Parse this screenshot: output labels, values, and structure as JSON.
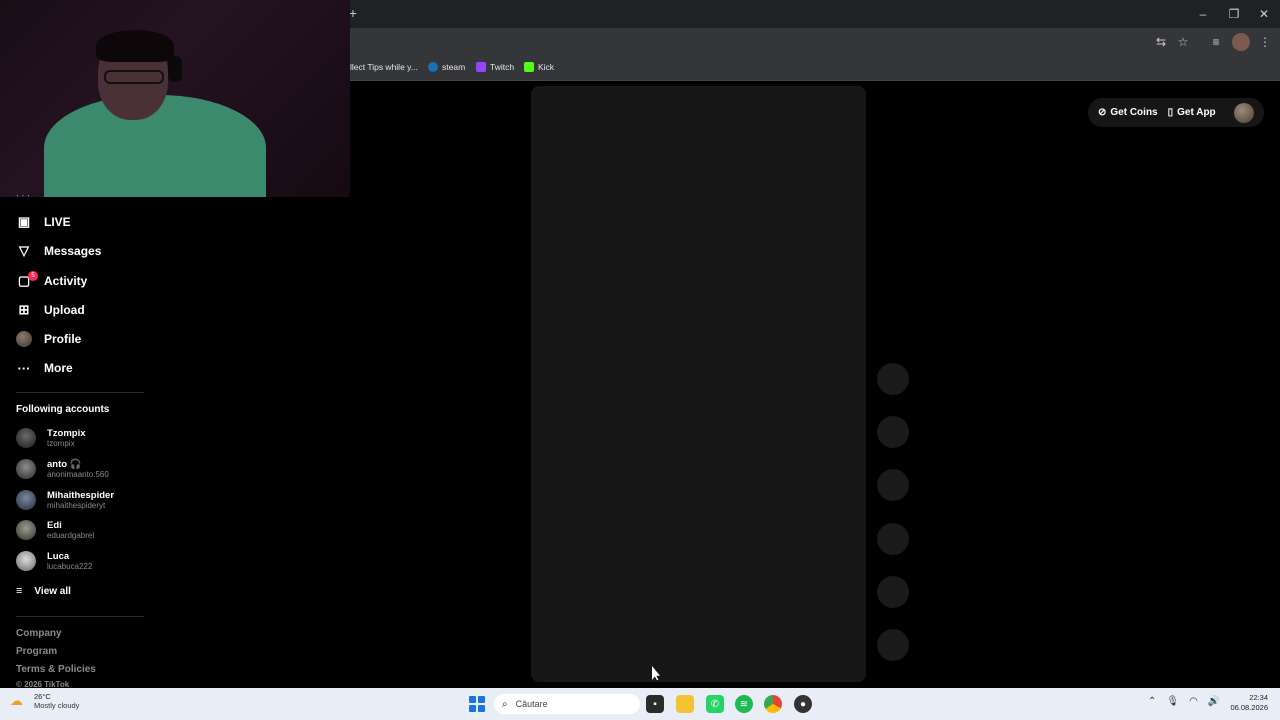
{
  "browser": {
    "new_tab_label": "+",
    "window_controls": {
      "minimize": "–",
      "restore": "❐",
      "close": "✕"
    },
    "bookmarks": [
      {
        "label": "llect Tips while y...",
        "icon": "bookmark-icon",
        "color": "#35363a"
      },
      {
        "label": "steam",
        "icon": "steam-icon",
        "color": "#1b2838"
      },
      {
        "label": "Twitch",
        "icon": "twitch-icon",
        "color": "#9146ff"
      },
      {
        "label": "Kick",
        "icon": "kick-icon",
        "color": "#53fc18"
      }
    ]
  },
  "sidebar": {
    "more_dots": "· · ·",
    "nav": [
      {
        "label": "LIVE",
        "icon": "live-icon"
      },
      {
        "label": "Messages",
        "icon": "messages-icon"
      },
      {
        "label": "Activity",
        "icon": "activity-icon",
        "badge": "5"
      },
      {
        "label": "Upload",
        "icon": "upload-icon"
      },
      {
        "label": "Profile",
        "icon": "profile-avatar"
      },
      {
        "label": "More",
        "icon": "more-icon"
      }
    ],
    "following_title": "Following accounts",
    "accounts": [
      {
        "name": "Tzompix",
        "handle": "tzompix"
      },
      {
        "name": "anto 🎧",
        "handle": "anonimaanto.560"
      },
      {
        "name": "Mihaithespider",
        "handle": "mihaithespideryt"
      },
      {
        "name": "Edi",
        "handle": "eduardgabrel"
      },
      {
        "name": "Luca",
        "handle": "lucabuca222"
      }
    ],
    "view_all": "View all",
    "footer": [
      "Company",
      "Program",
      "Terms & Policies",
      "© 2026 TikTok"
    ]
  },
  "header": {
    "get_coins": "Get Coins",
    "get_app": "Get App"
  },
  "taskbar": {
    "weather_temp": "26°C",
    "weather_cond": "Mostly cloudy",
    "search_placeholder": "Căutare",
    "time": "22:34",
    "date": "06.08.2026",
    "accent": "#1a73e8"
  }
}
